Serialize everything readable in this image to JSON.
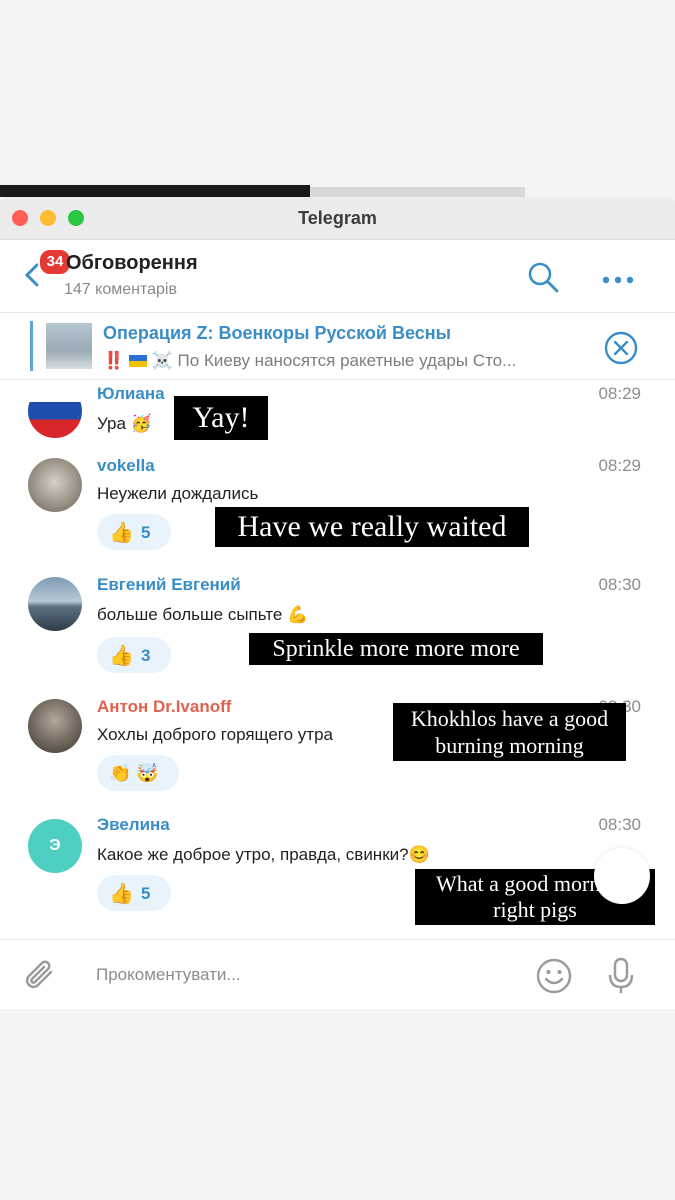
{
  "window": {
    "title": "Telegram"
  },
  "header": {
    "back_badge": "34",
    "title": "Обговорення",
    "subtitle": "147 коментарів"
  },
  "pinned": {
    "title": "Операция Z: Военкоры Русской Весны",
    "text": "По Киеву наносятся ракетные удары  Сто..."
  },
  "messages": [
    {
      "name": "Юлиана",
      "name_color": "#3a8ec7",
      "time": "08:29",
      "text": "Ура 🥳",
      "caption": "Yay!"
    },
    {
      "name": "vokella",
      "name_color": "#3a8ec7",
      "time": "08:29",
      "text": "Неужели дождались",
      "reaction": {
        "emoji": "👍",
        "count": "5"
      },
      "caption": "Have we really waited"
    },
    {
      "name": "Евгений Евгений",
      "name_color": "#3a8ec7",
      "time": "08:30",
      "text": "больше больше сыпьте 💪",
      "reaction": {
        "emoji": "👍",
        "count": "3"
      },
      "caption": "Sprinkle more more more"
    },
    {
      "name": "Антон Dr.Ivanoff",
      "name_color": "#e0624f",
      "time": "08:30",
      "text": "Хохлы доброго горящего утра",
      "reaction": {
        "emoji": "👏 🤯"
      },
      "caption": "Khokhlos have a good burning morning"
    },
    {
      "name": "Эвелина",
      "name_color": "#3a8ec7",
      "avatar_letter": "Э",
      "time": "08:30",
      "text": "Какое же доброе утро, правда, свинки?😊",
      "reaction": {
        "emoji": "👍",
        "count": "5"
      },
      "caption": "What a good morning, right pigs"
    }
  ],
  "input": {
    "placeholder": "Прокоментувати..."
  },
  "colors": {
    "accent": "#3a8ec7",
    "badge": "#e53935",
    "avatar_evelina": "#4dd0c1"
  }
}
